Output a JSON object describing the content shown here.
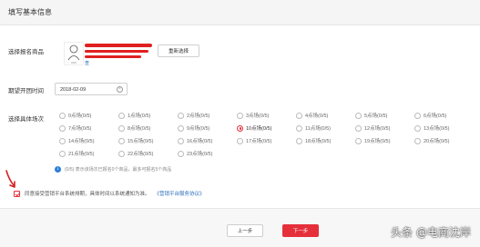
{
  "header": {
    "title": "填写基本信息"
  },
  "form": {
    "product_label": "选择报名商品",
    "product_link": "查",
    "reselect_button": "重新选择",
    "date_label": "期望开团时间",
    "date_value": "2018-02-09",
    "slots_label": "选择具体场次",
    "slots": [
      [
        "0点场(0/5)",
        "1点场(0/5)",
        "2点场(0/5)",
        "3点场(0/5)",
        "4点场(0/5)",
        "5点场(0/5)",
        "6点场(0/5)"
      ],
      [
        "7点场(0/5)",
        "8点场(0/5)",
        "9点场(0/5)",
        "10点场(0/5)",
        "11点场(0/5)",
        "12点场(0/5)",
        "13点场(0/5)"
      ],
      [
        "14点场(0/5)",
        "15点场(0/5)",
        "16点场(0/5)",
        "17点场(0/5)",
        "18点场(0/5)",
        "19点场(0/5)",
        "20点场(0/5)"
      ],
      [
        "21点场(0/5)",
        "22点场(0/5)",
        "23点场(0/5)"
      ]
    ],
    "selected_slot": "10点场(0/5)",
    "info_text": "(0/5) 表示该场次已报名0个商品，最多可报名5个商品",
    "agree_text": "同意接受营销平台系统排期，具体时间以系统通知为准。",
    "agree_link": "《营销平台服务协议》"
  },
  "footer": {
    "prev_button": "上一步",
    "next_button": "下一步"
  },
  "watermark": "头条 @电商沈岸",
  "colors": {
    "accent": "#e5303b",
    "link": "#2a6ebb",
    "info": "#2a7fd6"
  }
}
